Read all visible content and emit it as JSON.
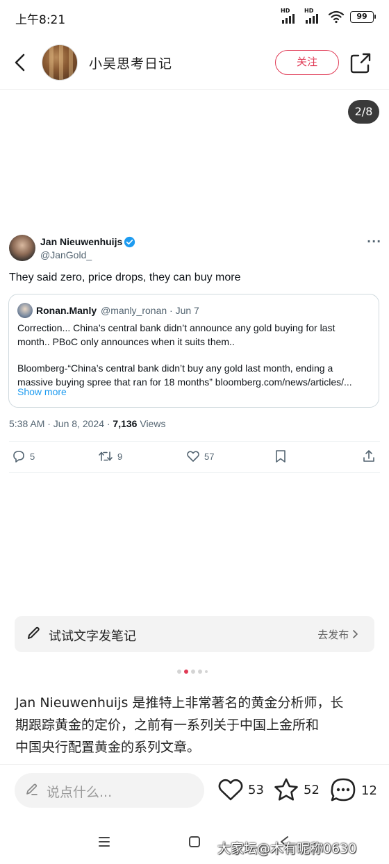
{
  "status_bar": {
    "time": "上午8:21",
    "battery": "99",
    "signal1_label": "HD",
    "signal2_label": "HD"
  },
  "header": {
    "author_name": "小吴思考日记",
    "follow_label": "关注"
  },
  "image_viewer": {
    "page_counter": "2/8"
  },
  "tweet": {
    "name": "Jan Nieuwenhuijs",
    "handle": "@JanGold_",
    "more": "···",
    "text": "They said zero, price drops, they can buy more",
    "quote": {
      "name": "Ronan.Manly",
      "meta": "@manly_ronan · Jun 7",
      "line1": "Correction... China’s central bank didn’t announce any gold buying for last",
      "line2": "month.. PBoC only announces when it suits them..",
      "line3": "Bloomberg-“China’s central bank didn’t buy any gold last month, ending a",
      "line4": "massive buying spree that ran for 18 months” bloomberg.com/news/articles/...",
      "show_more": "Show more"
    },
    "time_prefix": "5:38 AM · Jun 8, 2024 · ",
    "views_count": "7,136",
    "views_label": " Views",
    "replies": "5",
    "retweets": "9",
    "likes": "57"
  },
  "note_prompt": {
    "text": "试试文字发笔记",
    "link": "去发布"
  },
  "carousel": {
    "active_index": 1,
    "total_dots": 5
  },
  "description": {
    "line1": "Jan Nieuwenhuijs 是推特上非常著名的黄金分析师，长",
    "line2": "期跟踪黄金的定价，之前有一系列关于中国上金所和",
    "line3": "中国央行配置黄金的系列文章。"
  },
  "bottom_bar": {
    "comment_placeholder": "说点什么...",
    "likes": "53",
    "favorites": "52",
    "comments": "12"
  },
  "watermark": "大家坛@木有昵称0630",
  "colors": {
    "accent": "#e03a55",
    "link_blue": "#1d9bf0",
    "verified_blue": "#1d9bf0"
  }
}
